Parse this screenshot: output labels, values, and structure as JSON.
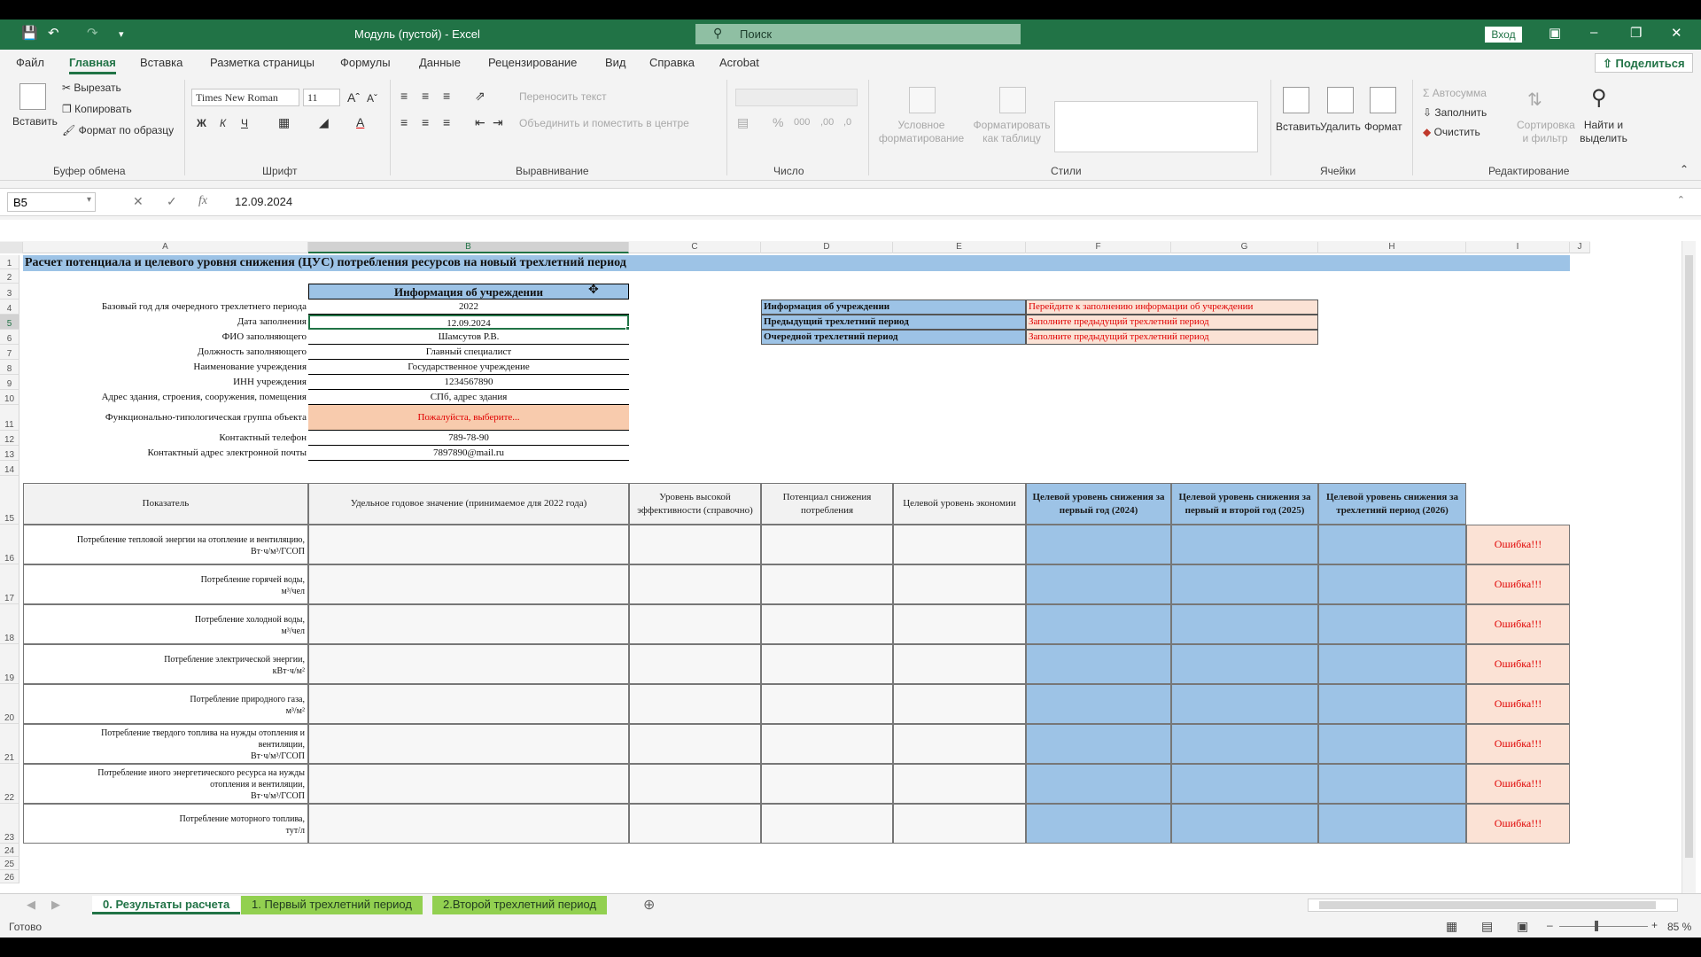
{
  "titlebar": {
    "title": "Модуль (пустой)  -  Excel",
    "search_placeholder": "Поиск",
    "login": "Вход"
  },
  "menu": {
    "tabs": [
      "Файл",
      "Главная",
      "Вставка",
      "Разметка страницы",
      "Формулы",
      "Данные",
      "Рецензирование",
      "Вид",
      "Справка",
      "Acrobat"
    ],
    "active": "Главная",
    "share": "Поделиться"
  },
  "ribbon": {
    "paste": "Вставить",
    "cut": "Вырезать",
    "copy": "Копировать",
    "format_painter": "Формат по образцу",
    "clipboard_group": "Буфер обмена",
    "font_name": "Times New Roman",
    "font_size": "11",
    "bold": "Ж",
    "italic": "К",
    "underline": "Ч",
    "font_group": "Шрифт",
    "wrap_text": "Переносить текст",
    "merge_center": "Объединить и поместить в центре",
    "alignment_group": "Выравнивание",
    "number_group": "Число",
    "conditional_formatting": "Условное форматирование",
    "format_as_table": "Форматировать как таблицу",
    "styles_group": "Стили",
    "insert": "Вставить",
    "delete": "Удалить",
    "format": "Формат",
    "cells_group": "Ячейки",
    "autosum": "Автосумма",
    "fill": "Заполнить",
    "clear": "Очистить",
    "sort_filter": "Сортировка и фильтр",
    "find_select": "Найти и выделить",
    "editing_group": "Редактирование"
  },
  "formula_bar": {
    "name_box": "B5",
    "fx": "fx",
    "content": "12.09.2024"
  },
  "columns": [
    "A",
    "B",
    "C",
    "D",
    "E",
    "F",
    "G",
    "H",
    "I",
    "J"
  ],
  "selected_column": "B",
  "rows": [
    "1",
    "2",
    "3",
    "4",
    "5",
    "6",
    "7",
    "8",
    "9",
    "10",
    "11",
    "12",
    "13",
    "14",
    "15",
    "16",
    "17",
    "18",
    "19",
    "20",
    "21",
    "22",
    "23",
    "24",
    "25",
    "26"
  ],
  "selected_row": "5",
  "sheet": {
    "title": "Расчет потенциала и целевого уровня снижения (ЦУС) потребления ресурсов на новый трехлетний период",
    "info_header": "Информация об учреждении",
    "info": [
      {
        "label": "Базовый год для очередного трехлетнего периода",
        "value": "2022"
      },
      {
        "label": "Дата заполнения",
        "value": "12.09.2024"
      },
      {
        "label": "ФИО заполняющего",
        "value": "Шамсутов Р.В."
      },
      {
        "label": "Должность заполняющего",
        "value": "Главный специалист"
      },
      {
        "label": "Наименование учреждения",
        "value": "Государственное учреждение"
      },
      {
        "label": "ИНН учреждения",
        "value": "1234567890"
      },
      {
        "label": "Адрес здания, строения, сооружения, помещения",
        "value": "СПб, адрес здания"
      },
      {
        "label": "Функционально-типологическая группа объекта",
        "value": "Пожалуйста, выберите..."
      },
      {
        "label": "Контактный телефон",
        "value": "789-78-90"
      },
      {
        "label": "Контактный адрес электронной почты",
        "value": "7897890@mail.ru"
      }
    ],
    "status": [
      {
        "label": "Информация об учреждении",
        "value": "Перейдите к заполнению информации об учреждении"
      },
      {
        "label": "Предыдущий трехлетний период",
        "value": "Заполните предыдущий трехлетний период"
      },
      {
        "label": "Очередной трехлетний период",
        "value": "Заполните предыдущий трехлетний период"
      }
    ],
    "table_headers": [
      "Показатель",
      "Удельное годовое значение (принимаемое для 2022 года)",
      "Уровень высокой эффективности (справочно)",
      "Потенциал снижения потребления",
      "Целевой уровень экономии",
      "Целевой уровень снижения за первый год (2024)",
      "Целевой уровень снижения за первый и второй год (2025)",
      "Целевой уровень снижения за трехлетний период (2026)"
    ],
    "indicators": [
      {
        "line1": "Потребление тепловой энергии на отопление и вентиляцию,",
        "line2": "Вт·ч/м³/ГСОП",
        "line3": ""
      },
      {
        "line1": "Потребление горячей воды,",
        "line2": "м³/чел",
        "line3": ""
      },
      {
        "line1": "Потребление холодной воды,",
        "line2": "м³/чел",
        "line3": ""
      },
      {
        "line1": "Потребление электрической энергии,",
        "line2": "кВт·ч/м²",
        "line3": ""
      },
      {
        "line1": "Потребление природного газа,",
        "line2": "м³/м²",
        "line3": ""
      },
      {
        "line1": "Потребление твердого топлива на нужды отопления и",
        "line2": "вентиляции,",
        "line3": "Вт·ч/м³/ГСОП"
      },
      {
        "line1": "Потребление иного энергетического ресурса на  нужды",
        "line2": "отопления и вентиляции,",
        "line3": "Вт·ч/м³/ГСОП"
      },
      {
        "line1": "Потребление моторного топлива,",
        "line2": "тут/л",
        "line3": ""
      }
    ],
    "error_text": "Ошибка!!!"
  },
  "sheet_tabs": [
    "0. Результаты расчета",
    "1. Первый трехлетний период",
    "2.Второй трехлетний период"
  ],
  "active_sheet": "0. Результаты расчета",
  "status": {
    "ready": "Готово",
    "zoom": "85 %"
  },
  "colors": {
    "excel_green": "#217346",
    "header_blue": "#9dc3e6",
    "salmon": "#f8cbad",
    "error_red": "#e00000",
    "tab_green": "#92d050"
  }
}
